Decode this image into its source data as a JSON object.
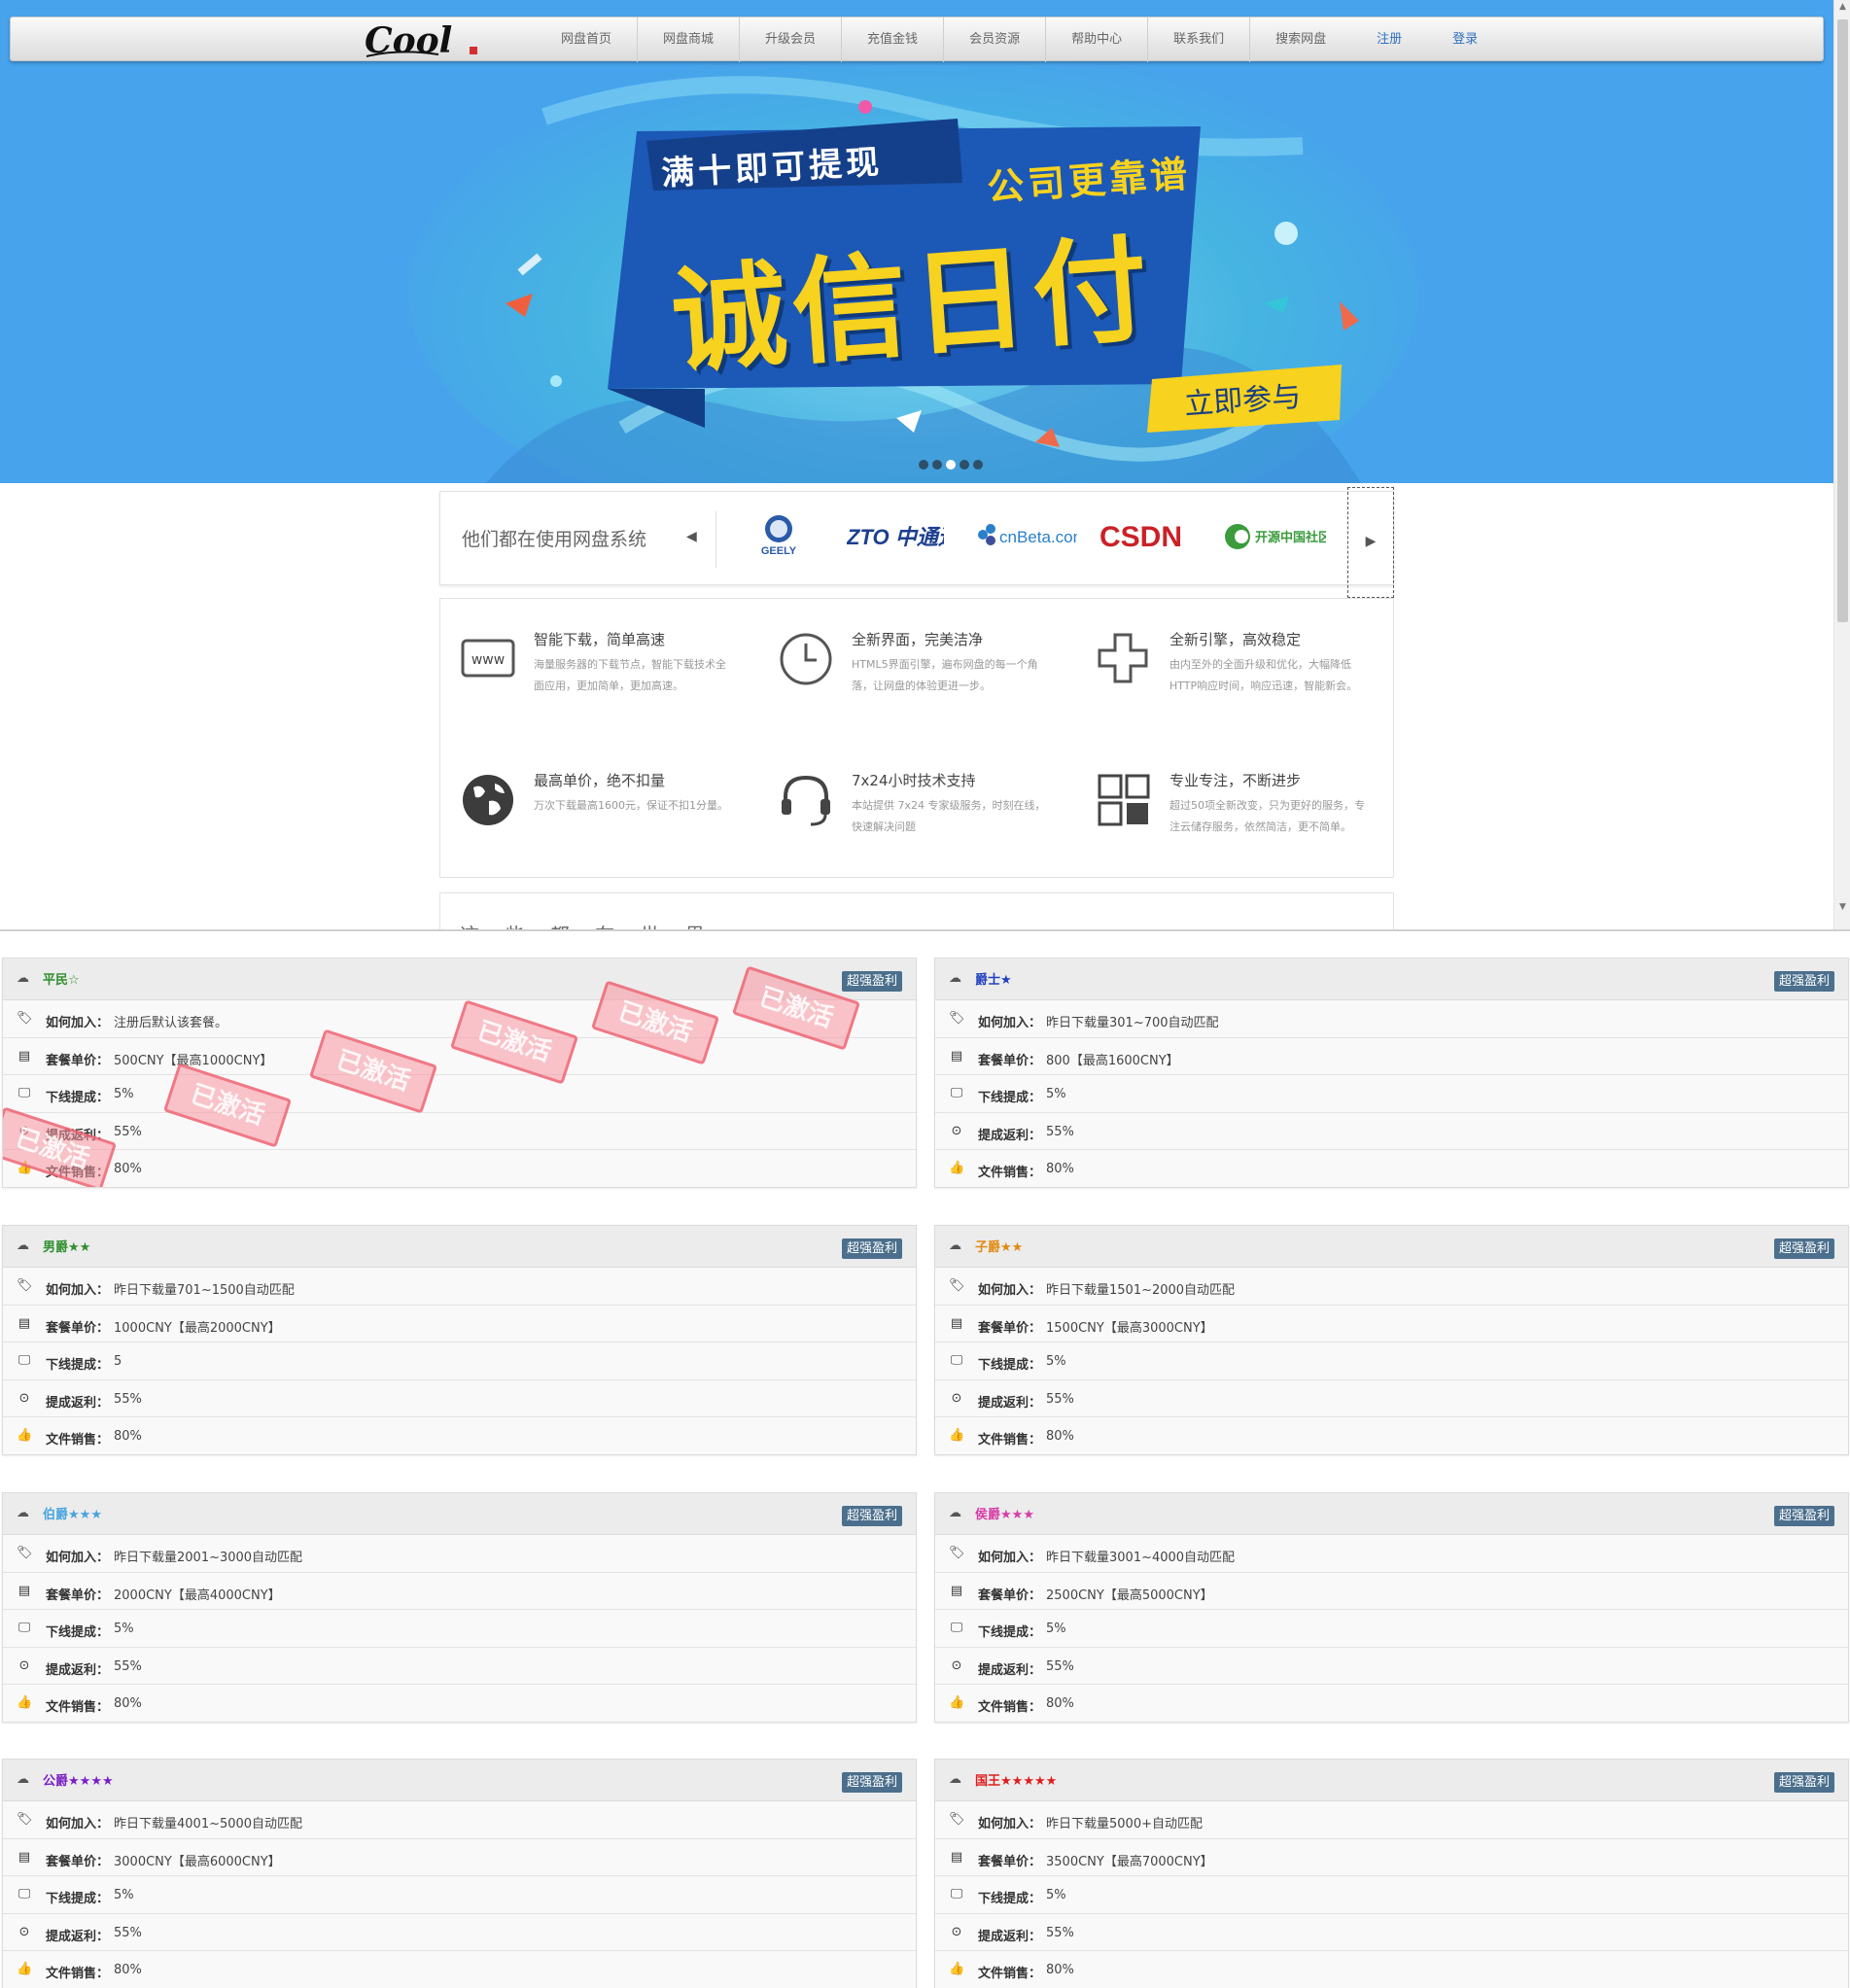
{
  "nav": {
    "logo_text": "Cool",
    "items": [
      "网盘首页",
      "网盘商城",
      "升级会员",
      "充值金钱",
      "会员资源",
      "帮助中心",
      "联系我们",
      "搜索网盘"
    ],
    "register": "注册",
    "login": "登录"
  },
  "banner": {
    "headline_top": "满十即可提现",
    "headline_side": "公司更靠谱",
    "headline_main": "诚信日付",
    "cta": "立即参与",
    "slide_count": 5,
    "active_slide": 3
  },
  "partners": {
    "title": "他们都在使用网盘系统",
    "logos": [
      {
        "name": "GEELY",
        "color": "#2a5aa8"
      },
      {
        "name": "ZTO 中通速递",
        "color": "#1c3f8f"
      },
      {
        "name": "cnBeta.com",
        "color": "#2a7fc9"
      },
      {
        "name": "CSDN",
        "color": "#cc2027"
      },
      {
        "name": "开源中国社区",
        "color": "#3a9c3c"
      }
    ]
  },
  "features": [
    {
      "icon": "www-icon",
      "title": "智能下载，简单高速",
      "desc": "海量服务器的下载节点，智能下载技术全面应用，更加简单，更加高速。"
    },
    {
      "icon": "clock-icon",
      "title": "全新界面，完美洁净",
      "desc": "HTML5界面引擎，遍布网盘的每一个角落，让网盘的体验更进一步。"
    },
    {
      "icon": "plus-icon",
      "title": "全新引擎，高效稳定",
      "desc": "由内至外的全面升级和优化，大幅降低HTTP响应时间，响应迅速，智能新会。"
    },
    {
      "icon": "globe-icon",
      "title": "最高单价，绝不扣量",
      "desc": "万次下载最高1600元，保证不扣1分量。"
    },
    {
      "icon": "headset-icon",
      "title": "7x24小时技术支持",
      "desc": "本站提供 7x24 专家级服务，时刻在线，快速解决问题"
    },
    {
      "icon": "grid-icon",
      "title": "专业专注，不断进步",
      "desc": "超过50项全新改变，只为更好的服务，专注云储存服务，依然简洁，更不简单。"
    }
  ],
  "section3": {
    "title": "这 些 都 在 世 界"
  },
  "labels": {
    "join": "如何加入：",
    "price": "套餐单价：",
    "commission": "下线提成：",
    "rebate": "提成返利：",
    "sales": "文件销售："
  },
  "badge_text": "超强盈利",
  "stamp_text": "已激活",
  "tiers": [
    {
      "name": "平民",
      "stars": "☆",
      "color": "#2f8f2f",
      "join": "注册后默认该套餐。",
      "price": "500CNY【最高1000CNY】",
      "commission": "5%",
      "rebate": "55%",
      "sales": "80%",
      "stamped": true
    },
    {
      "name": "爵士",
      "stars": "★",
      "color": "#1f3fbf",
      "join": "昨日下载量301~700自动匹配",
      "price": "800【最高1600CNY】",
      "commission": "5%",
      "rebate": "55%",
      "sales": "80%",
      "stamped": false
    },
    {
      "name": "男爵",
      "stars": "★★",
      "color": "#2f8f2f",
      "join": "昨日下载量701~1500自动匹配",
      "price": "1000CNY【最高2000CNY】",
      "commission": "5",
      "rebate": "55%",
      "sales": "80%",
      "stamped": false
    },
    {
      "name": "子爵",
      "stars": "★★",
      "color": "#e08a14",
      "join": "昨日下载量1501~2000自动匹配",
      "price": "1500CNY【最高3000CNY】",
      "commission": "5%",
      "rebate": "55%",
      "sales": "80%",
      "stamped": false
    },
    {
      "name": "伯爵",
      "stars": "★★★",
      "color": "#48a4de",
      "join": "昨日下载量2001~3000自动匹配",
      "price": "2000CNY【最高4000CNY】",
      "commission": "5%",
      "rebate": "55%",
      "sales": "80%",
      "stamped": false
    },
    {
      "name": "侯爵",
      "stars": "★★★",
      "color": "#d63ca8",
      "join": "昨日下载量3001~4000自动匹配",
      "price": "2500CNY【最高5000CNY】",
      "commission": "5%",
      "rebate": "55%",
      "sales": "80%",
      "stamped": false
    },
    {
      "name": "公爵",
      "stars": "★★★★",
      "color": "#7a1fc4",
      "join": "昨日下载量4001~5000自动匹配",
      "price": "3000CNY【最高6000CNY】",
      "commission": "5%",
      "rebate": "55%",
      "sales": "80%",
      "stamped": false
    },
    {
      "name": "国王",
      "stars": "★★★★★",
      "color": "#e01c1c",
      "join": "昨日下载量5000+自动匹配",
      "price": "3500CNY【最高7000CNY】",
      "commission": "5%",
      "rebate": "55%",
      "sales": "80%",
      "stamped": false
    }
  ]
}
